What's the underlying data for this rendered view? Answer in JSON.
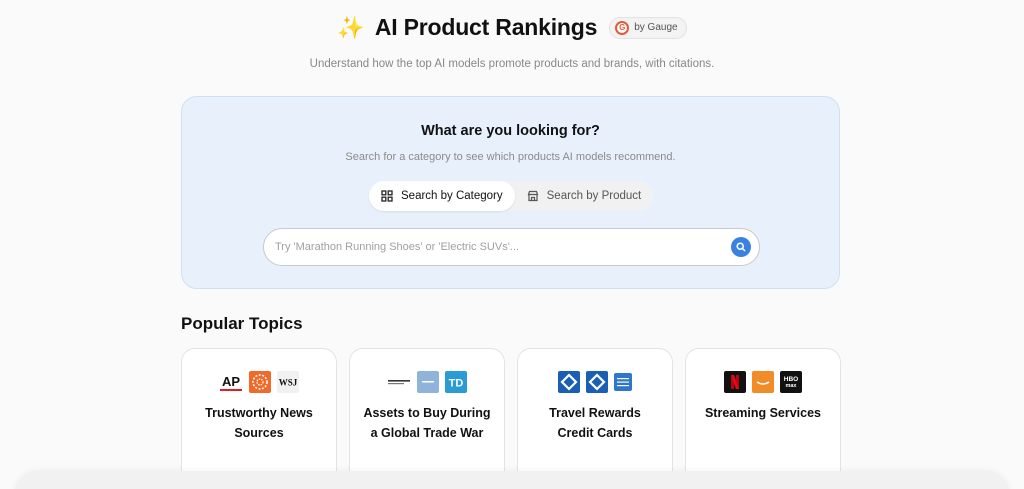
{
  "header": {
    "title": "AI Product Rankings",
    "badge_label": "by Gauge",
    "badge_letter": "G",
    "subtitle": "Understand how the top AI models promote products and brands, with citations."
  },
  "search": {
    "title": "What are you looking for?",
    "subtitle": "Search for a category to see which products AI models recommend.",
    "tabs": [
      {
        "label": "Search by Category",
        "icon": "grid-icon",
        "active": true
      },
      {
        "label": "Search by Product",
        "icon": "store-icon",
        "active": false
      }
    ],
    "placeholder": "Try 'Marathon Running Shoes' or 'Electric SUVs'..."
  },
  "popular": {
    "title": "Popular Topics",
    "cards": [
      {
        "label": "Trustworthy News Sources",
        "logos": [
          "AP",
          "Reuters",
          "WSJ"
        ]
      },
      {
        "label": "Assets to Buy During a Global Trade War",
        "logos": [
          "fund-logo",
          "TD"
        ]
      },
      {
        "label": "Travel Rewards Credit Cards",
        "logos": [
          "Chase",
          "Chase",
          "Amex"
        ]
      },
      {
        "label": "Streaming Services",
        "logos": [
          "Netflix",
          "Amazon",
          "HBO max"
        ]
      }
    ]
  },
  "colors": {
    "panel_bg": "#e8f1fb",
    "accent_blue": "#3b82e0",
    "gauge_orange": "#e8583a"
  }
}
